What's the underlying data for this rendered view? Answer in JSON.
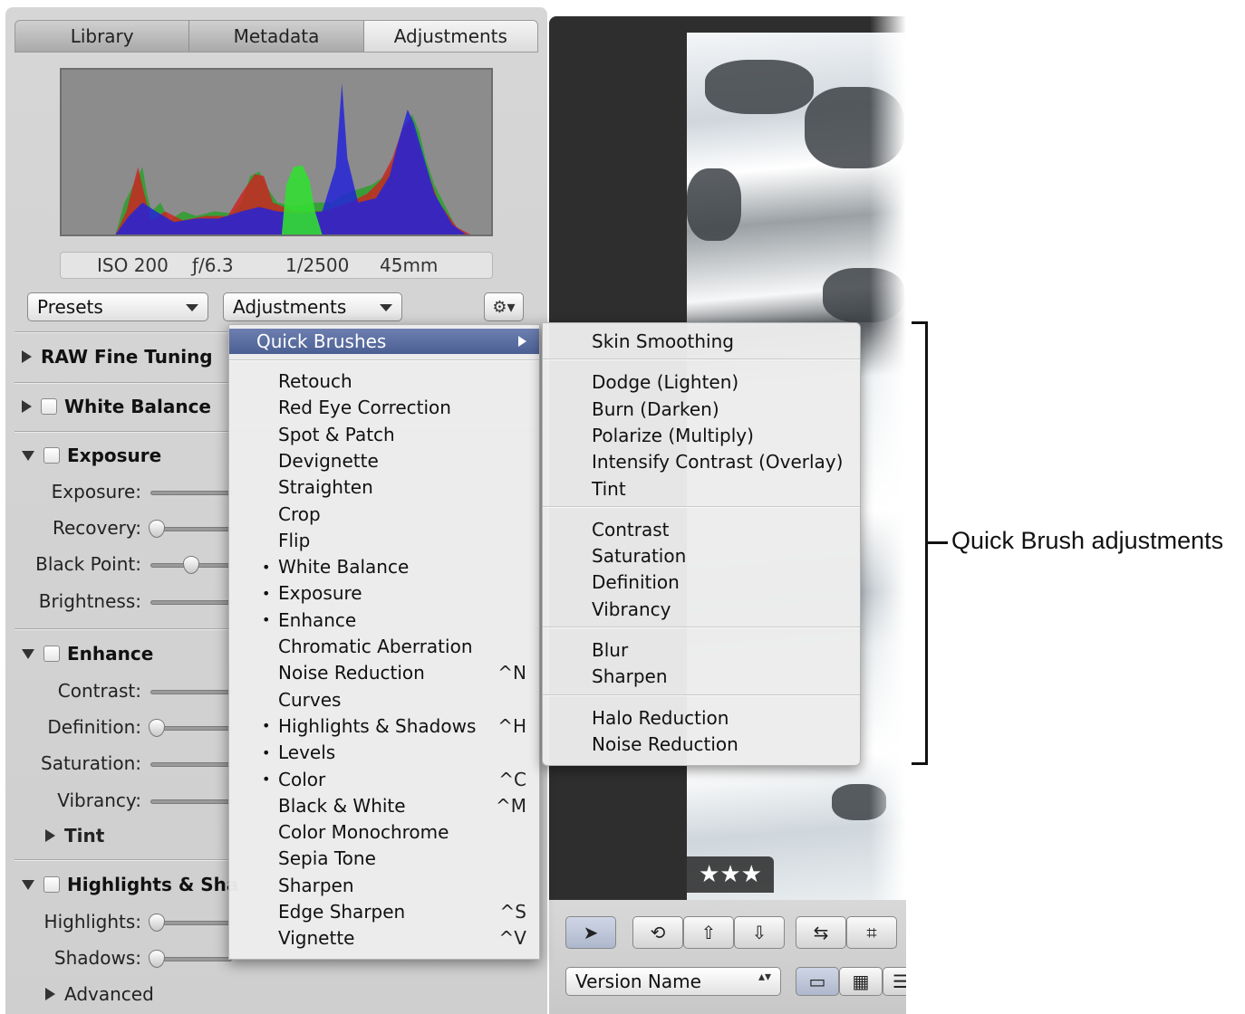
{
  "tabs": [
    {
      "label": "Library"
    },
    {
      "label": "Metadata"
    },
    {
      "label": "Adjustments"
    }
  ],
  "exif": {
    "iso": "ISO 200",
    "aperture": "ƒ/6.3",
    "shutter": "1/2500",
    "focal": "45mm"
  },
  "toolbar": {
    "presets_label": "Presets",
    "adjustments_label": "Adjustments",
    "gear_glyph": "⚙▾"
  },
  "sections": {
    "raw": "RAW Fine Tuning",
    "white_balance": "White Balance",
    "exposure": "Exposure",
    "enhance": "Enhance",
    "highlights": "Highlights & Sha",
    "tint": "Tint",
    "advanced": "Advanced"
  },
  "sliders": {
    "exposure": "Exposure:",
    "recovery": "Recovery:",
    "black_point": "Black Point:",
    "brightness": "Brightness:",
    "contrast": "Contrast:",
    "definition": "Definition:",
    "saturation": "Saturation:",
    "vibrancy": "Vibrancy:",
    "highlights": "Highlights:",
    "shadows": "Shadows:"
  },
  "menu_main": {
    "quick_brushes": "Quick Brushes",
    "items": [
      {
        "label": "Retouch",
        "checked": false,
        "shortcut": ""
      },
      {
        "label": "Red Eye Correction",
        "checked": false,
        "shortcut": ""
      },
      {
        "label": "Spot & Patch",
        "checked": false,
        "shortcut": ""
      },
      {
        "label": "Devignette",
        "checked": false,
        "shortcut": ""
      },
      {
        "label": "Straighten",
        "checked": false,
        "shortcut": ""
      },
      {
        "label": "Crop",
        "checked": false,
        "shortcut": ""
      },
      {
        "label": "Flip",
        "checked": false,
        "shortcut": ""
      },
      {
        "label": "White Balance",
        "checked": true,
        "shortcut": ""
      },
      {
        "label": "Exposure",
        "checked": true,
        "shortcut": ""
      },
      {
        "label": "Enhance",
        "checked": true,
        "shortcut": ""
      },
      {
        "label": "Chromatic Aberration",
        "checked": false,
        "shortcut": ""
      },
      {
        "label": "Noise Reduction",
        "checked": false,
        "shortcut": "^N"
      },
      {
        "label": "Curves",
        "checked": false,
        "shortcut": ""
      },
      {
        "label": "Highlights & Shadows",
        "checked": true,
        "shortcut": "^H"
      },
      {
        "label": "Levels",
        "checked": true,
        "shortcut": ""
      },
      {
        "label": "Color",
        "checked": true,
        "shortcut": "^C"
      },
      {
        "label": "Black & White",
        "checked": false,
        "shortcut": "^M"
      },
      {
        "label": "Color Monochrome",
        "checked": false,
        "shortcut": ""
      },
      {
        "label": "Sepia Tone",
        "checked": false,
        "shortcut": ""
      },
      {
        "label": "Sharpen",
        "checked": false,
        "shortcut": ""
      },
      {
        "label": "Edge Sharpen",
        "checked": false,
        "shortcut": "^S"
      },
      {
        "label": "Vignette",
        "checked": false,
        "shortcut": "^V"
      }
    ],
    "bullet": "•"
  },
  "menu_sub": {
    "groups": [
      [
        "Skin Smoothing"
      ],
      [
        "Dodge (Lighten)",
        "Burn (Darken)",
        "Polarize (Multiply)",
        "Intensify Contrast (Overlay)",
        "Tint"
      ],
      [
        "Contrast",
        "Saturation",
        "Definition",
        "Vibrancy"
      ],
      [
        "Blur",
        "Sharpen"
      ],
      [
        "Halo Reduction",
        "Noise Reduction"
      ]
    ]
  },
  "viewer": {
    "rating": "★★★",
    "version_label": "Version Name",
    "select_arrows": "▴▾"
  },
  "annotation": {
    "text": "Quick Brush adjustments"
  },
  "colors": {
    "highlight": "#5567a0",
    "histogram_bg": "#8c8c8c"
  }
}
